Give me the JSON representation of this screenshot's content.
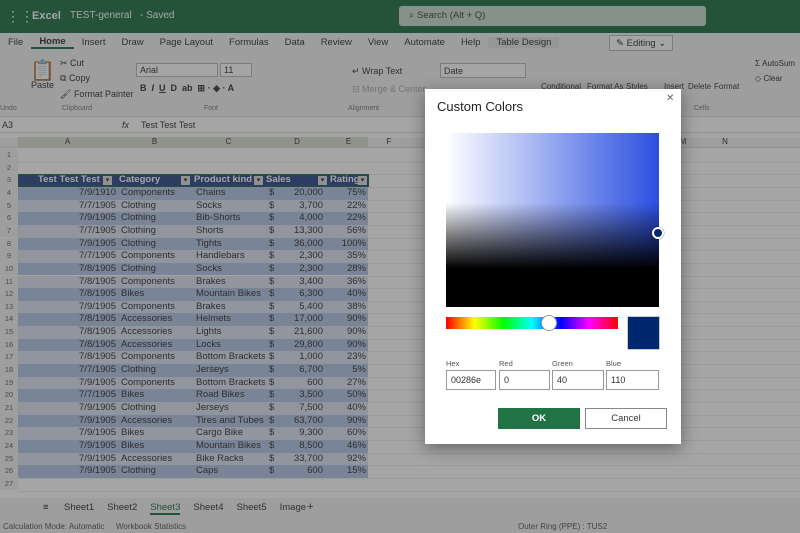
{
  "titlebar": {
    "app": "Excel",
    "doc": "TEST-general",
    "status": "- Saved",
    "search_placeholder": "Search (Alt + Q)"
  },
  "menu": [
    "File",
    "Home",
    "Insert",
    "Draw",
    "Page Layout",
    "Formulas",
    "Data",
    "Review",
    "View",
    "Automate",
    "Help",
    "Table Design"
  ],
  "editing": "Editing",
  "ribbon": {
    "paste": "Paste",
    "cut": "Cut",
    "copy": "Copy",
    "format_painter": "Format Painter",
    "font": "Arial",
    "size": "11",
    "wrap": "Wrap Text",
    "merge": "Merge & Center",
    "number_format": "Date",
    "conditional": "Conditional",
    "format_as": "Format As",
    "styles": "Styles",
    "insert": "Insert",
    "delete": "Delete",
    "format": "Format",
    "autosum": "AutoSum",
    "clear": "Clear",
    "groups": {
      "undo": "Undo",
      "clipboard": "Clipboard",
      "font": "Font",
      "alignment": "Alignment",
      "cells": "Cells"
    }
  },
  "formula": {
    "cell_ref": "A3",
    "fx": "fx",
    "value": "Test Test Test"
  },
  "columns": [
    "A",
    "B",
    "C",
    "D",
    "E",
    "F",
    "G",
    "H",
    "I",
    "J",
    "K",
    "L",
    "M",
    "N"
  ],
  "table": {
    "headers": [
      "Test Test Test",
      "Category",
      "Product kind",
      "Sales",
      "Rating"
    ],
    "rows": [
      [
        "7/9/1910",
        "Components",
        "Chains",
        "$",
        "20,000",
        "75%"
      ],
      [
        "7/7/1905",
        "Clothing",
        "Socks",
        "$",
        "3,700",
        "22%"
      ],
      [
        "7/9/1905",
        "Clothing",
        "Bib-Shorts",
        "$",
        "4,000",
        "22%"
      ],
      [
        "7/7/1905",
        "Clothing",
        "Shorts",
        "$",
        "13,300",
        "56%"
      ],
      [
        "7/9/1905",
        "Clothing",
        "Tights",
        "$",
        "36,000",
        "100%"
      ],
      [
        "7/7/1905",
        "Components",
        "Handlebars",
        "$",
        "2,300",
        "35%"
      ],
      [
        "7/8/1905",
        "Clothing",
        "Socks",
        "$",
        "2,300",
        "28%"
      ],
      [
        "7/8/1905",
        "Components",
        "Brakes",
        "$",
        "3,400",
        "36%"
      ],
      [
        "7/8/1905",
        "Bikes",
        "Mountain Bikes",
        "$",
        "6,300",
        "40%"
      ],
      [
        "7/9/1905",
        "Components",
        "Brakes",
        "$",
        "5,400",
        "38%"
      ],
      [
        "7/8/1905",
        "Accessories",
        "Helmets",
        "$",
        "17,000",
        "90%"
      ],
      [
        "7/8/1905",
        "Accessories",
        "Lights",
        "$",
        "21,600",
        "90%"
      ],
      [
        "7/8/1905",
        "Accessories",
        "Locks",
        "$",
        "29,800",
        "90%"
      ],
      [
        "7/8/1905",
        "Components",
        "Bottom Brackets",
        "$",
        "1,000",
        "23%"
      ],
      [
        "7/7/1905",
        "Clothing",
        "Jerseys",
        "$",
        "6,700",
        "5%"
      ],
      [
        "7/9/1905",
        "Components",
        "Bottom Brackets",
        "$",
        "600",
        "27%"
      ],
      [
        "7/7/1905",
        "Bikes",
        "Road Bikes",
        "$",
        "3,500",
        "50%"
      ],
      [
        "7/9/1905",
        "Clothing",
        "Jerseys",
        "$",
        "7,500",
        "40%"
      ],
      [
        "7/9/1905",
        "Accessories",
        "Tires and Tubes",
        "$",
        "63,700",
        "90%"
      ],
      [
        "7/9/1905",
        "Bikes",
        "Cargo Bike",
        "$",
        "9,300",
        "60%"
      ],
      [
        "7/9/1905",
        "Bikes",
        "Mountain Bikes",
        "$",
        "8,500",
        "46%"
      ],
      [
        "7/9/1905",
        "Accessories",
        "Bike Racks",
        "$",
        "33,700",
        "92%"
      ],
      [
        "7/9/1905",
        "Clothing",
        "Caps",
        "$",
        "600",
        "15%"
      ]
    ]
  },
  "sheets": [
    "Sheet1",
    "Sheet2",
    "Sheet3",
    "Sheet4",
    "Sheet5",
    "Image"
  ],
  "active_sheet": "Sheet3",
  "status": {
    "calc": "Calculation Mode: Automatic",
    "stats": "Workbook Statistics",
    "ring": "Outer Ring (PPE) : TUS2"
  },
  "dialog": {
    "title": "Custom Colors",
    "hex_label": "Hex",
    "red_label": "Red",
    "green_label": "Green",
    "blue_label": "Blue",
    "hex": "00286e",
    "red": "0",
    "green": "40",
    "blue": "110",
    "ok": "OK",
    "cancel": "Cancel",
    "selected_color": "#00286e",
    "hue_position": 0.6
  },
  "colors": {
    "excel_green": "#217346",
    "table_header": "#2f4d8a",
    "band_dark": "#b4c6e7",
    "band_light": "#dbe4f3"
  }
}
